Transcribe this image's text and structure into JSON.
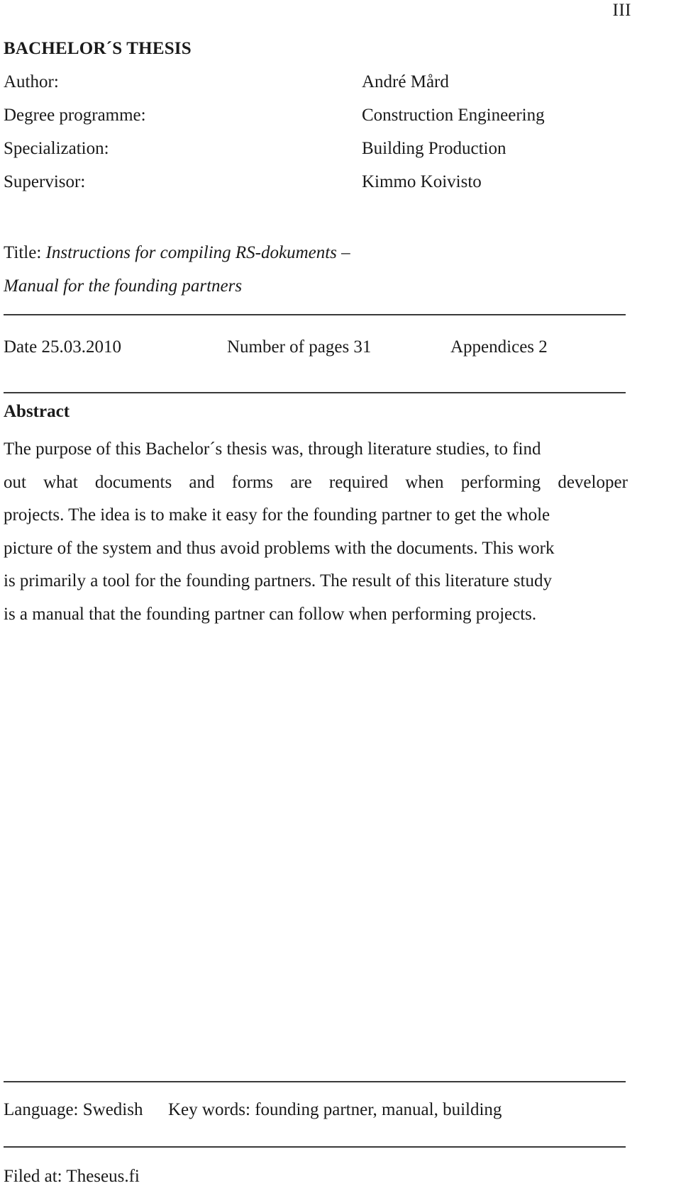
{
  "page": {
    "folio": "III",
    "heading": "BACHELOR´S THESIS"
  },
  "meta": {
    "rows": [
      {
        "label": "Author:",
        "value": "André Mård"
      },
      {
        "label": "Degree programme:",
        "value": "Construction Engineering"
      },
      {
        "label": "Specialization:",
        "value": "Building Production"
      },
      {
        "label": "Supervisor:",
        "value": "Kimmo Koivisto"
      }
    ]
  },
  "title": {
    "prefix": "Title:",
    "line1": "Instructions for compiling RS-dokuments –",
    "line2": "Manual for the founding partners"
  },
  "publication": {
    "date": "Date 25.03.2010",
    "pages": "Number of pages 31",
    "appendices": "Appendices 2"
  },
  "abstract": {
    "heading": "Abstract",
    "lines": [
      "The purpose of this Bachelor´s thesis was, through literature studies, to find",
      "out what documents and forms are required when performing developer",
      "projects. The idea is to make it easy for the founding partner to get the whole",
      "picture of the system and thus avoid problems with the documents. This work",
      "is primarily a tool for the founding partners. The result of this literature study",
      "is a manual that the founding partner can follow when performing projects."
    ],
    "line2_words": [
      "out",
      "what",
      "documents",
      "and",
      "forms",
      "are",
      "required",
      "when",
      "performing",
      "developer"
    ]
  },
  "footer": {
    "language": "Language: Swedish",
    "keywords": "Key words: founding partner, manual, building",
    "filed_at": "Filed at: Theseus.fi"
  }
}
